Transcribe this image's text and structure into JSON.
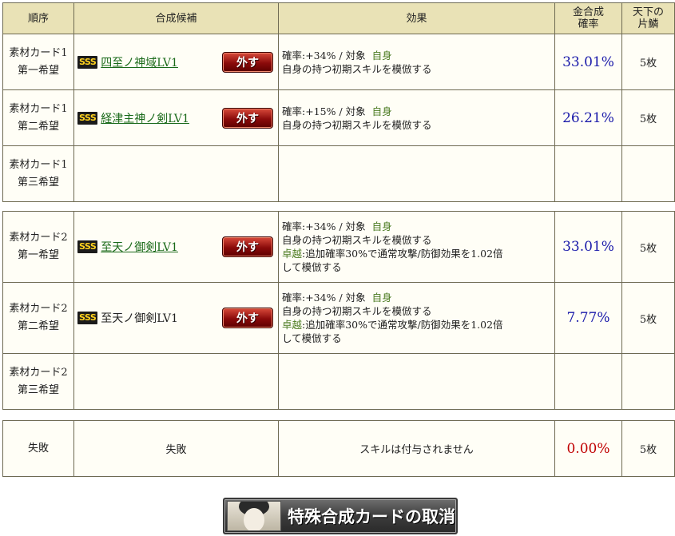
{
  "header": {
    "order": "順序",
    "candidate": "合成候補",
    "effect": "効果",
    "rate_line1": "金合成",
    "rate_line2": "確率",
    "scale_line1": "天下の",
    "scale_line2": "片鱗"
  },
  "groups": [
    {
      "rows": [
        {
          "order1": "素材カード1",
          "order2": "第一希望",
          "has_card": true,
          "rank": "SSS",
          "card_name": "四至ノ神域LV1",
          "card_link": true,
          "remove_label": "外す",
          "eff_rate": "確率:+34% / 対象",
          "eff_target": "自身",
          "eff_desc": "自身の持つ初期スキルを模倣する",
          "takuetsu": "",
          "rate": "33.01%",
          "scale": "5枚"
        },
        {
          "order1": "素材カード1",
          "order2": "第二希望",
          "has_card": true,
          "rank": "SSS",
          "card_name": "経津主神ノ剣LV1",
          "card_link": true,
          "remove_label": "外す",
          "eff_rate": "確率:+15% / 対象",
          "eff_target": "自身",
          "eff_desc": "自身の持つ初期スキルを模倣する",
          "takuetsu": "",
          "rate": "26.21%",
          "scale": "5枚"
        },
        {
          "order1": "素材カード1",
          "order2": "第三希望",
          "has_card": false
        }
      ]
    },
    {
      "rows": [
        {
          "order1": "素材カード2",
          "order2": "第一希望",
          "has_card": true,
          "rank": "SSS",
          "card_name": "至天ノ御剣LV1",
          "card_link": true,
          "remove_label": "外す",
          "eff_rate": "確率:+34% / 対象",
          "eff_target": "自身",
          "eff_desc": "自身の持つ初期スキルを模倣する",
          "takuetsu": "卓越",
          "takuetsu_desc1": ":追加確率30%で通常攻撃/防御効果を1.02倍",
          "takuetsu_desc2": "して模倣する",
          "rate": "33.01%",
          "scale": "5枚"
        },
        {
          "order1": "素材カード2",
          "order2": "第二希望",
          "has_card": true,
          "rank": "SSS",
          "card_name": "至天ノ御剣LV1",
          "card_link": false,
          "remove_label": "外す",
          "eff_rate": "確率:+34% / 対象",
          "eff_target": "自身",
          "eff_desc": "自身の持つ初期スキルを模倣する",
          "takuetsu": "卓越",
          "takuetsu_desc1": ":追加確率30%で通常攻撃/防御効果を1.02倍",
          "takuetsu_desc2": "して模倣する",
          "rate": "7.77%",
          "scale": "5枚"
        },
        {
          "order1": "素材カード2",
          "order2": "第三希望",
          "has_card": false
        }
      ]
    }
  ],
  "failure": {
    "order": "失敗",
    "candidate": "失敗",
    "effect": "スキルは付与されません",
    "rate": "0.00%",
    "scale": "5枚"
  },
  "cancel_button": {
    "label": "特殊合成カードの取消"
  },
  "colors": {
    "header_bg": "#e9e2b6",
    "border": "#6e6a52",
    "rate_blue": "#1a1aaa",
    "rate_red": "#c00000",
    "link_green": "#1a6a1a",
    "accent_green": "#4a7a20"
  }
}
